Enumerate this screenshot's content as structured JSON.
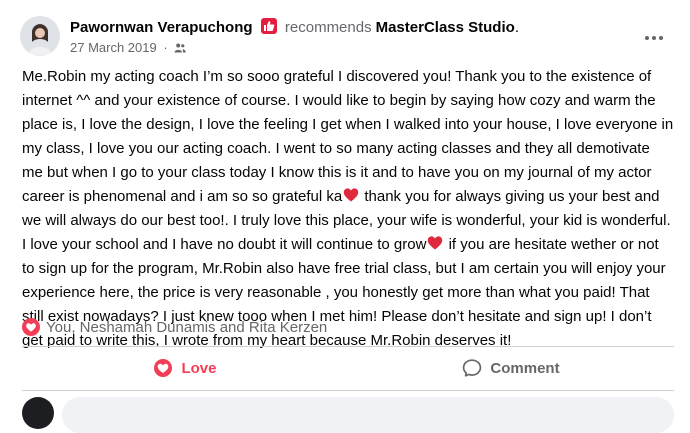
{
  "header": {
    "author_name": "Pawornwan Verapuchong",
    "recommends_word": "recommends",
    "page_name": "MasterClass Studio",
    "page_suffix": ".",
    "date": "27 March 2019",
    "separator": "·",
    "audience_icon": "friends-icon",
    "more_icon": "more-options-icon"
  },
  "post": {
    "text_1": "Me.Robin my acting coach I’m so sooo grateful I discovered you! Thank you to the existence of internet ^^ and your existence of course. I would like to begin by saying how cozy and warm the place is, I love the design, I love the feeling I get when I walked into your house, I love everyone in my class, I love you our acting coach. I went to so many acting classes and they all demotivate me but when I go to your class today I know this is it and to have you on my journal of my actor career is phenomenal and i am so so grateful ka",
    "text_2": " thank you for always giving us your best and we will always do our best too!. I truly love this place, your wife is wonderful, your kid is wonderful. I love your school and I have no doubt it will continue to grow",
    "text_3": " if you are hesitate wether or not to sign up for the program, Mr.Robin also have free trial class, but I am certain you will enjoy your experience here, the price is very reasonable , you honestly get more than what you paid! That still exist nowadays? I just knew tooo when I met him! Please don’t hesitate and sign up! I don’t get paid to write this, I wrote from my heart because Mr.Robin deserves it!",
    "emoji": "red-heart-icon"
  },
  "reactions": {
    "icon": "love-reaction-icon",
    "names": "You, Neshamah Dunamis and Rita Kerzen"
  },
  "actions": {
    "love_label": "Love",
    "comment_label": "Comment"
  },
  "colors": {
    "love": "#f33e58",
    "recommend_badge": "#e41e3f",
    "secondary_text": "#65676b",
    "divider": "#ced0d4"
  }
}
